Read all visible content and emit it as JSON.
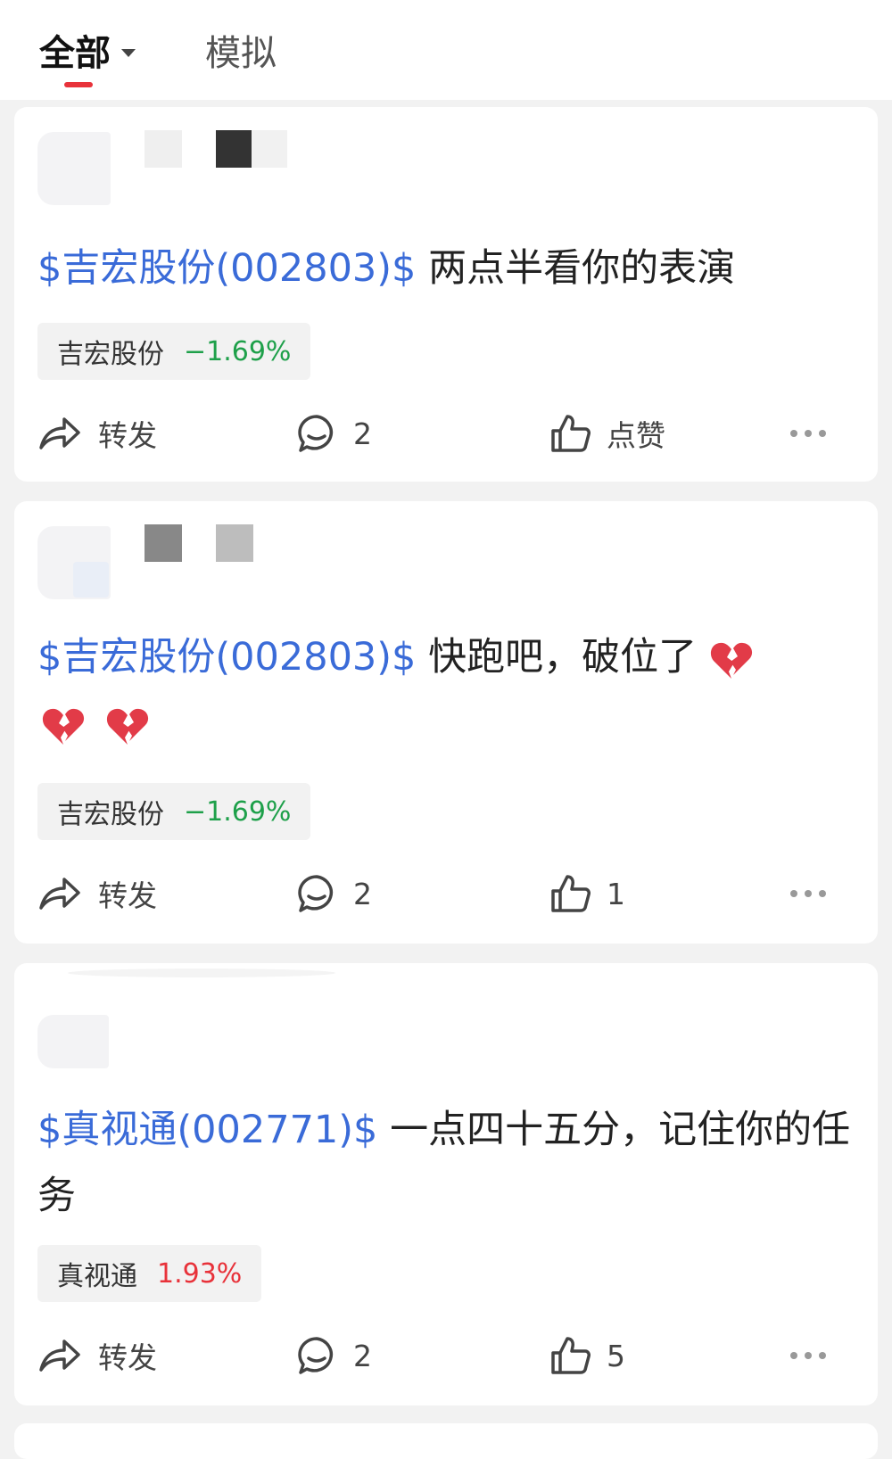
{
  "tabs": {
    "all_label": "全部",
    "sim_label": "模拟"
  },
  "colors": {
    "link": "#3a6bd8",
    "down": "#1ea04a",
    "up": "#e8323a",
    "tab_indicator": "#e8323a"
  },
  "posts": [
    {
      "stock_link": "$吉宏股份(002803)$",
      "text": " 两点半看你的表演",
      "emojis": [],
      "chip": {
        "name": "吉宏股份",
        "change": "−1.69%",
        "direction": "down"
      },
      "actions": {
        "share": "转发",
        "comments": "2",
        "likes": "点赞"
      }
    },
    {
      "stock_link": "$吉宏股份(002803)$",
      "text": " 快跑吧，破位了",
      "emojis": [
        "broken-heart",
        "broken-heart",
        "broken-heart"
      ],
      "chip": {
        "name": "吉宏股份",
        "change": "−1.69%",
        "direction": "down"
      },
      "actions": {
        "share": "转发",
        "comments": "2",
        "likes": "1"
      }
    },
    {
      "stock_link": "$真视通(002771)$",
      "text": " 一点四十五分，记住你的任务",
      "emojis": [],
      "chip": {
        "name": "真视通",
        "change": "1.93%",
        "direction": "up"
      },
      "actions": {
        "share": "转发",
        "comments": "2",
        "likes": "5"
      }
    }
  ]
}
